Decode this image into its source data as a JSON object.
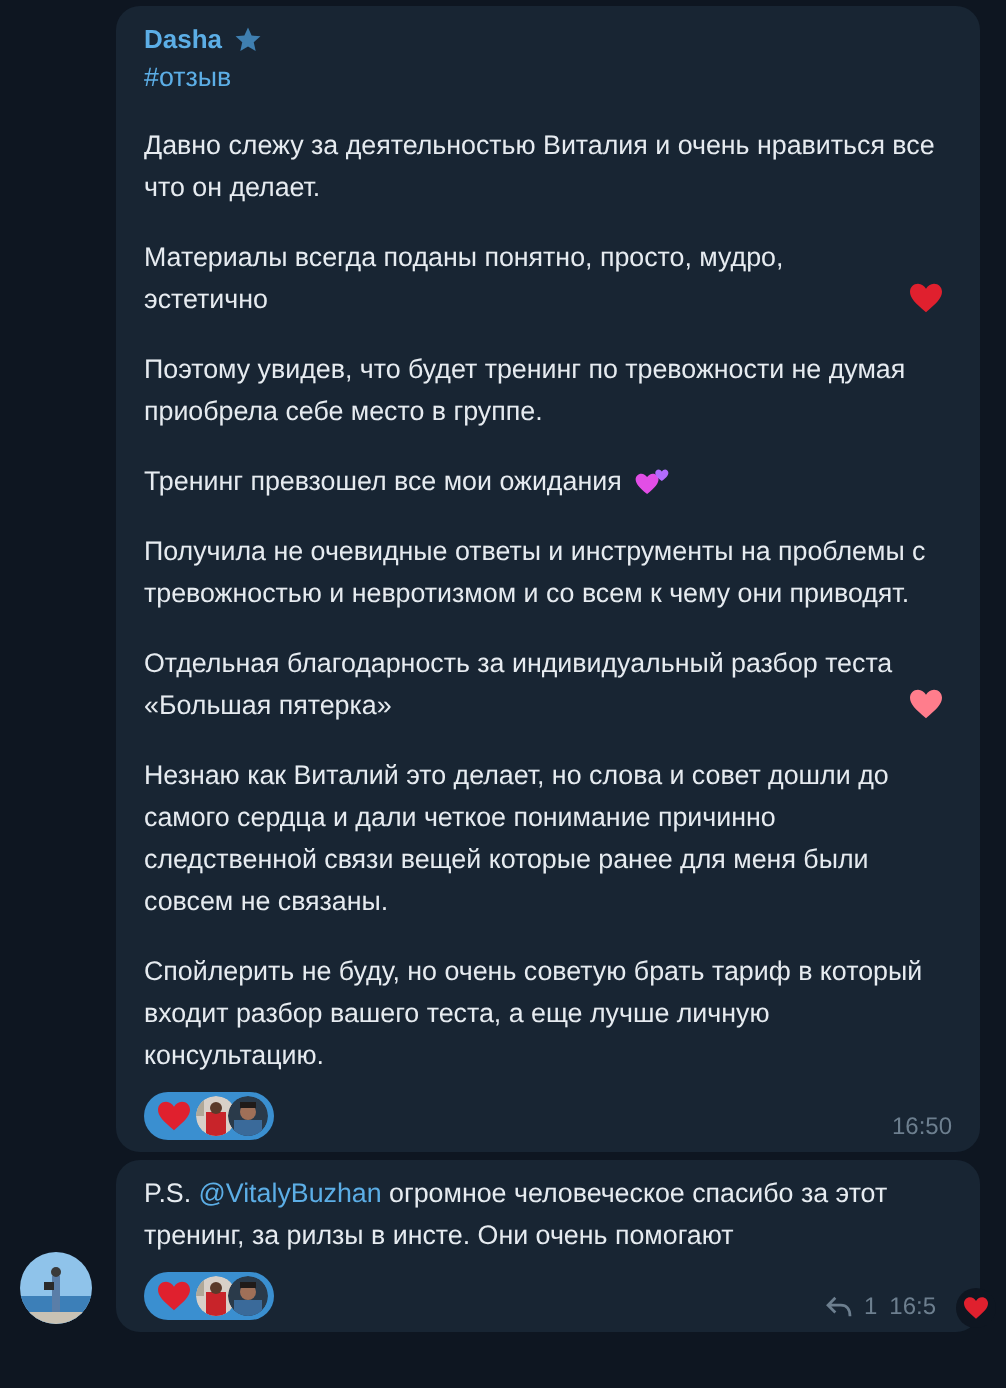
{
  "messages": [
    {
      "author": {
        "name": "Dasha",
        "starred": true
      },
      "hashtag": "#отзыв",
      "paragraphs": [
        {
          "kind": "plain",
          "text": "Давно слежу за деятельностью Виталия и очень нравиться все что он делает."
        },
        {
          "kind": "red-heart",
          "text": "Материалы всегда поданы понятно, просто, мудро, эстетично"
        },
        {
          "kind": "plain",
          "text": "Поэтому увидев, что будет тренинг по тревожности не думая приобрела себе место в группе."
        },
        {
          "kind": "two-hearts",
          "text": "Тренинг превзошел все мои ожидания"
        },
        {
          "kind": "plain",
          "text": "Получила не очевидные ответы и инструменты на проблемы с тревожностью и невротизмом и со всем к чему они  приводят."
        },
        {
          "kind": "pink-heart",
          "text": "Отдельная благодарность за индивидуальный разбор теста «Большая пятерка»"
        },
        {
          "kind": "plain",
          "text": "Незнаю как Виталий это делает, но слова и совет дошли до самого сердца и дали четкое понимание причинно следственной связи вещей которые ранее для меня были совсем не связаны."
        },
        {
          "kind": "plain",
          "text": "Спойлерить не буду, но очень советую брать тариф в который входит разбор вашего теста, а еще лучше личную консультацию."
        }
      ],
      "reaction": {
        "chosen": true
      },
      "time": "16:50"
    },
    {
      "prefix": "P.S.",
      "mention": "@VitalyBuzhan",
      "text": "огромное человеческое спасибо за этот тренинг, за рилзы в инсте. Они очень помогают",
      "reaction": {
        "chosen": true
      },
      "replies": "1",
      "time": "16:5"
    }
  ]
}
